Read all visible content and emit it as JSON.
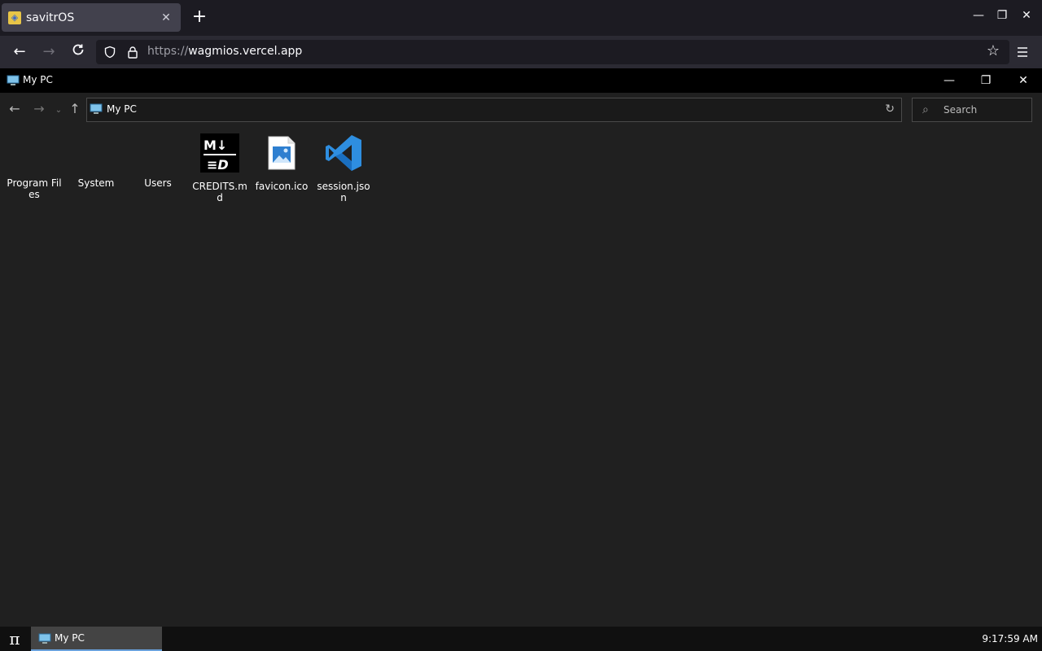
{
  "browser": {
    "tab_title": "savitrOS",
    "url_scheme": "https://",
    "url_host": "wagmios.vercel.app"
  },
  "window": {
    "title": "My PC"
  },
  "explorer": {
    "address": "My PC",
    "search_placeholder": "Search",
    "items": [
      {
        "label": "Program Files",
        "icon": "folder-icon"
      },
      {
        "label": "System",
        "icon": "folder-icon"
      },
      {
        "label": "Users",
        "icon": "folder-icon"
      },
      {
        "label": "CREDITS.md",
        "icon": "markdown-file-icon"
      },
      {
        "label": "favicon.ico",
        "icon": "image-file-icon"
      },
      {
        "label": "session.json",
        "icon": "vscode-file-icon"
      }
    ]
  },
  "taskbar": {
    "start_label": "π",
    "task_label": "My PC",
    "clock": "9:17:59 AM"
  },
  "colors": {
    "accent": "#6aa1dc",
    "vscode_blue": "#2e8ee0",
    "explorer_bg": "#202020"
  }
}
